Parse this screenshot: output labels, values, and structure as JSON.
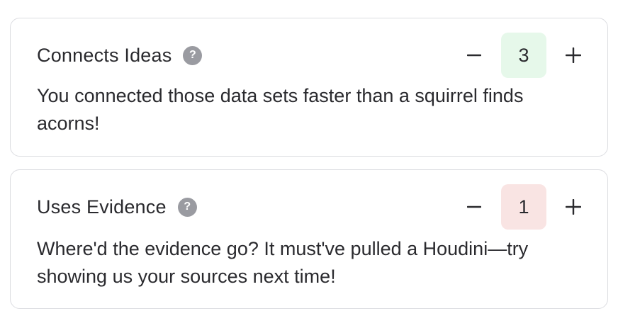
{
  "criteria": [
    {
      "title": "Connects Ideas",
      "help_glyph": "?",
      "score": "3",
      "score_color": "#e6f8ea",
      "decrement_icon": "minus-icon",
      "increment_icon": "plus-icon",
      "comment": "You connected those data sets faster than a squirrel finds acorns!"
    },
    {
      "title": "Uses Evidence",
      "help_glyph": "?",
      "score": "1",
      "score_color": "#f9e4e3",
      "decrement_icon": "minus-icon",
      "increment_icon": "plus-icon",
      "comment": "Where'd the evidence go? It must've pulled a Houdini—try showing us your sources next time!"
    }
  ]
}
